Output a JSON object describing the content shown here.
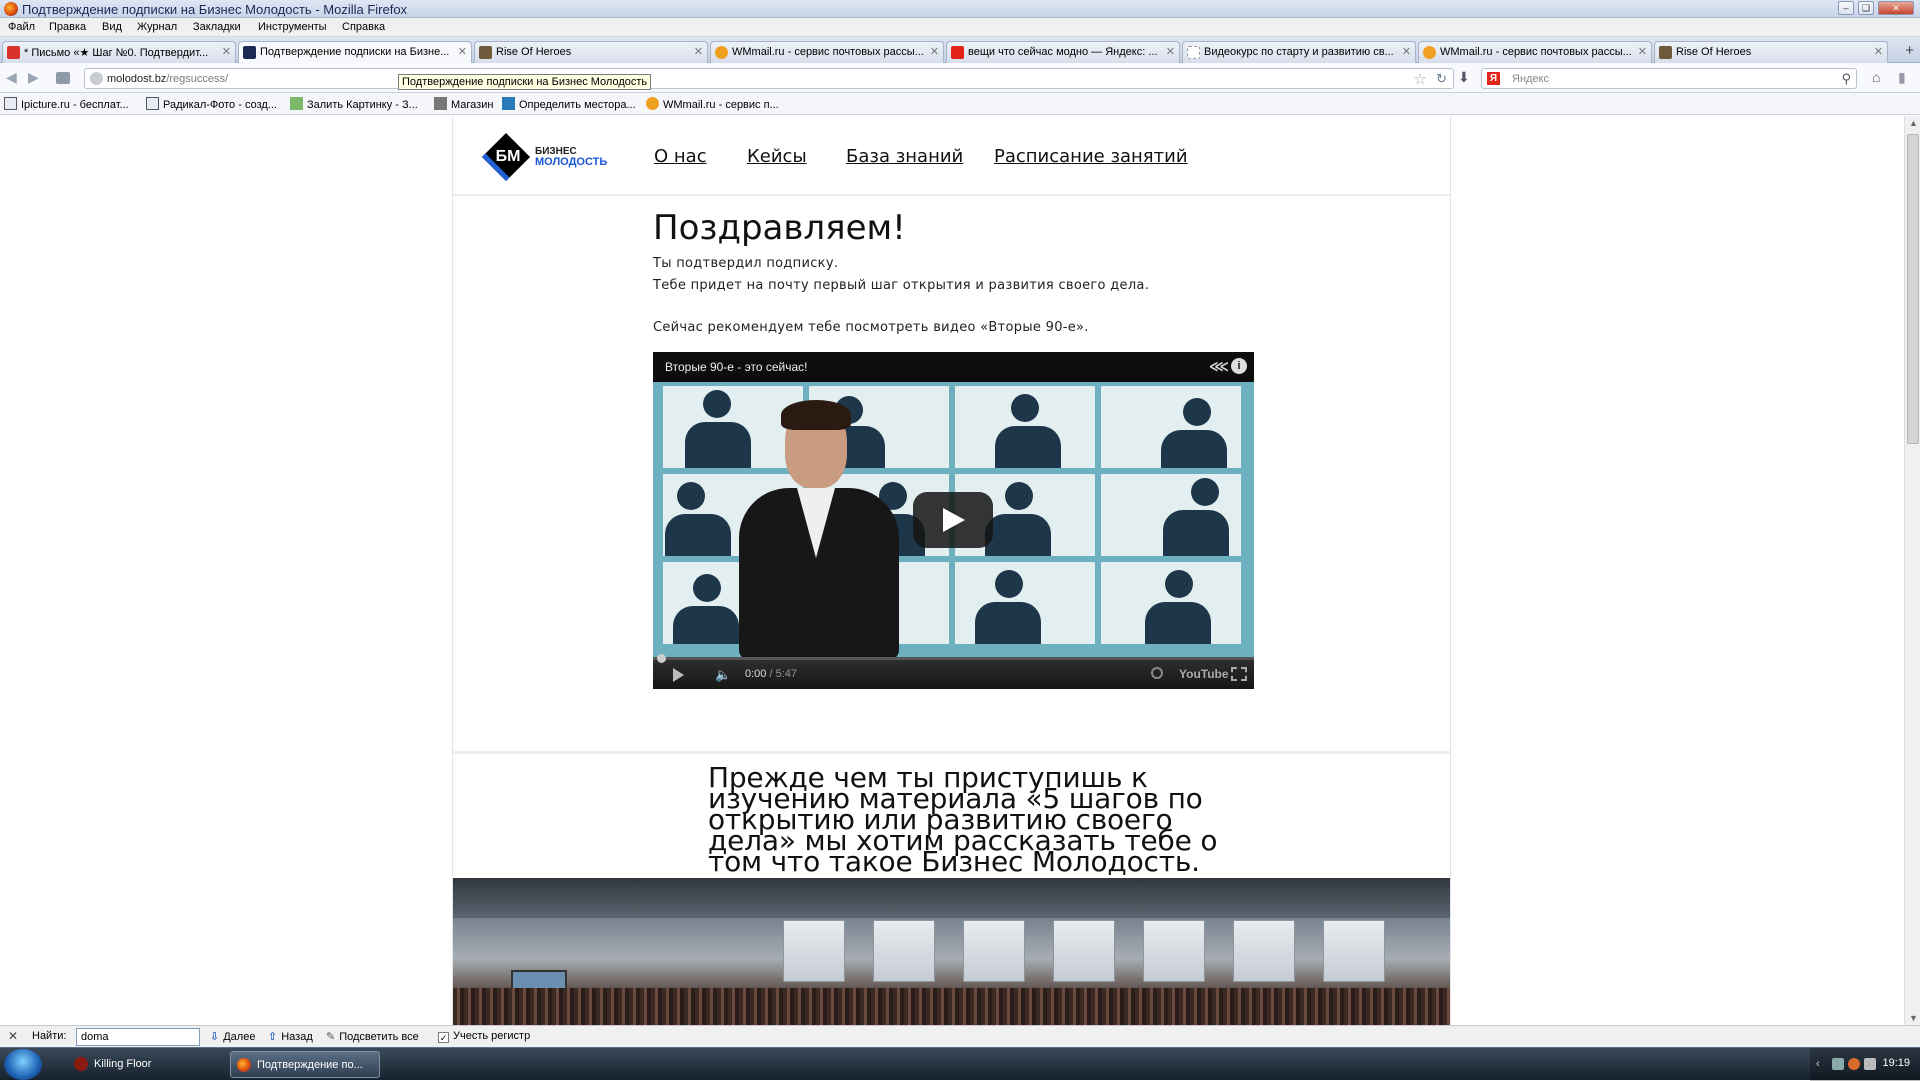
{
  "window": {
    "title": "Подтверждение подписки на Бизнес Молодость - Mozilla Firefox",
    "min_icon": "minimize-icon",
    "max_icon": "maximize-icon",
    "close_icon": "close-icon"
  },
  "menubar": [
    "Файл",
    "Правка",
    "Вид",
    "Журнал",
    "Закладки",
    "Инструменты",
    "Справка"
  ],
  "tabs": [
    {
      "label": "* Письмо «★ Шаг №0. Подтвердит...",
      "icon": "mail-icon",
      "icon_color": "#d9322c",
      "active": false
    },
    {
      "label": "Подтверждение подписки на Бизне...",
      "icon": "bm-site-icon",
      "icon_color": "#1a2a55",
      "active": true
    },
    {
      "label": "Rise Of Heroes",
      "icon": "game-icon",
      "icon_color": "#6e5a3a",
      "active": false
    },
    {
      "label": "WMmail.ru - сервис почтовых рассы...",
      "icon": "wmmail-icon",
      "icon_color": "#f0a020",
      "active": false
    },
    {
      "label": "вещи что сейчас модно — Яндекс: ...",
      "icon": "yandex-icon",
      "icon_color": "#e2231a",
      "active": false
    },
    {
      "label": "Видеокурс по старту и развитию св...",
      "icon": "page-icon",
      "icon_color": "#cccccc",
      "active": false
    },
    {
      "label": "WMmail.ru - сервис почтовых рассы...",
      "icon": "wmmail-icon",
      "icon_color": "#f0a020",
      "active": false
    },
    {
      "label": "Rise Of Heroes",
      "icon": "game-icon",
      "icon_color": "#6e5a3a",
      "active": false
    }
  ],
  "navbar": {
    "url_domain": "molodost.bz",
    "url_path": "/regsuccess/",
    "tooltip": "Подтверждение подписки на Бизнес Молодость",
    "search_placeholder": "Яндекс",
    "search_engine_letter": "Я"
  },
  "bookmarks": [
    {
      "label": "Ipicture.ru - бесплат...",
      "icon": "ipicture-icon"
    },
    {
      "label": "Радикал-Фото - созд...",
      "icon": "radikal-icon"
    },
    {
      "label": "Залить Картинку - З...",
      "icon": "image-upload-icon"
    },
    {
      "label": "Магазин",
      "icon": "shop-icon"
    },
    {
      "label": "Определить местора...",
      "icon": "ip-icon"
    },
    {
      "label": "WMmail.ru - сервис п...",
      "icon": "wmmail-icon"
    }
  ],
  "site": {
    "logo": {
      "letters": "БМ",
      "word1": "БИЗНЕС",
      "word2": "МОЛОДОСТЬ"
    },
    "nav": [
      "О нас",
      "Кейсы",
      "База знаний",
      "Расписание занятий"
    ],
    "heading": "Поздравляем!",
    "line1": "Ты подтвердил подписку.",
    "line2": "Тебе придет на почту первый шаг открытия и развития своего дела.",
    "line3": "Сейчас рекомендуем тебе посмотреть видео «Вторые 90-е».",
    "video": {
      "title": "Вторые 90-е - это сейчас!",
      "time_current": "0:00",
      "time_total": " / 5:47",
      "brand": "YouTube",
      "progress": 0
    },
    "promo": "Прежде чем ты приступишь к изучению материала «5 шагов по открытию или развитию своего дела» мы хотим рассказать тебе о том что такое Бизнес Молодость."
  },
  "findbar": {
    "label": "Найти:",
    "value": "doma",
    "next": "Далее",
    "prev": "Назад",
    "highlight": "Подсветить все",
    "match_case": "Учесть регистр"
  },
  "taskbar": {
    "items": [
      {
        "label": "Killing Floor",
        "icon": "killing-floor-icon"
      },
      {
        "label": "Подтверждение по...",
        "icon": "firefox-icon"
      }
    ],
    "clock": "19:19"
  },
  "colors": {
    "brand_blue": "#1a56d6",
    "video_bg": "#6db0bf",
    "silhouette": "#1d3649"
  }
}
